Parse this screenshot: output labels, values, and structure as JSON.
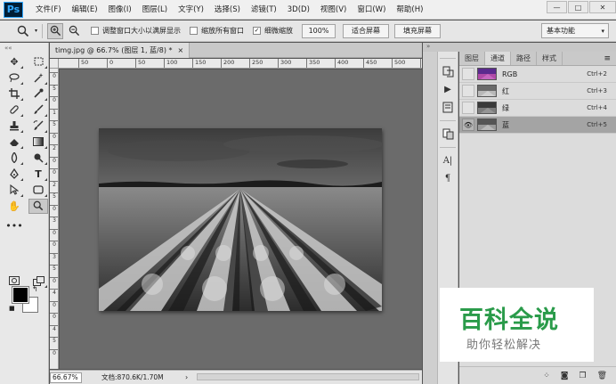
{
  "app": {
    "logo": "Ps",
    "menus": [
      "文件(F)",
      "编辑(E)",
      "图像(I)",
      "图层(L)",
      "文字(Y)",
      "选择(S)",
      "滤镜(T)",
      "3D(D)",
      "视图(V)",
      "窗口(W)",
      "帮助(H)"
    ],
    "window_controls": {
      "minimize": "—",
      "restore": "□",
      "close": "✕"
    }
  },
  "options_bar": {
    "checkboxes": [
      {
        "label": "调整窗口大小以满屏显示",
        "checked": false
      },
      {
        "label": "缩放所有窗口",
        "checked": false
      },
      {
        "label": "细微缩放",
        "checked": true
      }
    ],
    "zoom_value": "100%",
    "fit_screen": "适合屏幕",
    "fill_screen": "填充屏幕",
    "workspace": "基本功能"
  },
  "document": {
    "tab_title": "timg.jpg @ 66.7% (图层 1, 蓝/8) *",
    "close": "×",
    "ruler_h": [
      "50",
      "0",
      "50",
      "100",
      "150",
      "200",
      "250",
      "300",
      "350",
      "400",
      "450",
      "500",
      "550",
      "600",
      "650",
      "700",
      "750",
      "800"
    ],
    "ruler_v": [
      "0",
      "5",
      "0",
      "1",
      "5",
      "0",
      "2",
      "0",
      "0",
      "2",
      "5",
      "0",
      "3",
      "0",
      "0",
      "3",
      "5",
      "0",
      "4",
      "0",
      "0",
      "4",
      "5",
      "0"
    ]
  },
  "status": {
    "zoom": "66.67%",
    "doc_info": "文档:870.6K/1.70M",
    "arrow": "›"
  },
  "panel": {
    "tabs": [
      "图层",
      "通道",
      "路径",
      "样式"
    ],
    "active_tab": "通道",
    "menu_icon": "≡",
    "channels": [
      {
        "name": "RGB",
        "shortcut": "Ctrl+2",
        "thumb_color": "#7a3a8c",
        "visible": false,
        "selected": false
      },
      {
        "name": "红",
        "shortcut": "Ctrl+3",
        "thumb_color": "#9a9a9a",
        "visible": false,
        "selected": false
      },
      {
        "name": "绿",
        "shortcut": "Ctrl+4",
        "thumb_color": "#5c5c5c",
        "visible": false,
        "selected": false
      },
      {
        "name": "蓝",
        "shortcut": "Ctrl+5",
        "thumb_color": "#8a8a8a",
        "visible": true,
        "selected": true
      }
    ]
  },
  "dock": {
    "collapse": "»"
  },
  "toolbar": {
    "collapse": "««"
  },
  "watermark": {
    "title": "百科全说",
    "subtitle": "助你轻松解决",
    "title_color": "#2a9b4a"
  }
}
